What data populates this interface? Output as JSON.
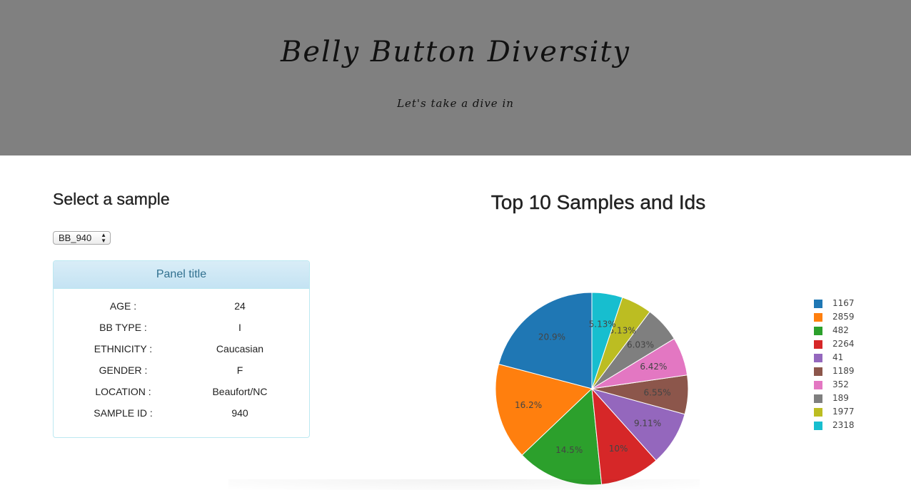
{
  "header": {
    "title": "Belly Button Diversity",
    "subtitle": "Let's take a dive in"
  },
  "selector": {
    "heading": "Select a sample",
    "selected": "BB_940"
  },
  "panel": {
    "title": "Panel title",
    "rows": [
      {
        "key": "AGE :",
        "value": "24"
      },
      {
        "key": "BB TYPE :",
        "value": "I"
      },
      {
        "key": "ETHNICITY :",
        "value": "Caucasian"
      },
      {
        "key": "GENDER :",
        "value": "F"
      },
      {
        "key": "LOCATION :",
        "value": "Beaufort/NC"
      },
      {
        "key": "SAMPLE ID :",
        "value": "940"
      }
    ]
  },
  "chart_data": {
    "type": "pie",
    "title": "Top 10 Samples and Ids",
    "labels": [
      "1167",
      "2859",
      "482",
      "2264",
      "41",
      "1189",
      "352",
      "189",
      "1977",
      "2318"
    ],
    "values": [
      20.9,
      16.2,
      14.5,
      10,
      9.11,
      6.55,
      6.42,
      6.03,
      5.13,
      5.13
    ],
    "slice_text": [
      "20.9%",
      "16.2%",
      "14.5%",
      "10%",
      "9.11%",
      "6.55%",
      "6.42%",
      "6.03%",
      "5.13%",
      "5.13%"
    ],
    "colors": [
      "#1f77b4",
      "#ff7f0e",
      "#2ca02c",
      "#d62728",
      "#9467bd",
      "#8c564b",
      "#e377c2",
      "#7f7f7f",
      "#bcbd22",
      "#17becf"
    ],
    "legend_position": "right",
    "direction": "counterclockwise",
    "start": "top"
  }
}
